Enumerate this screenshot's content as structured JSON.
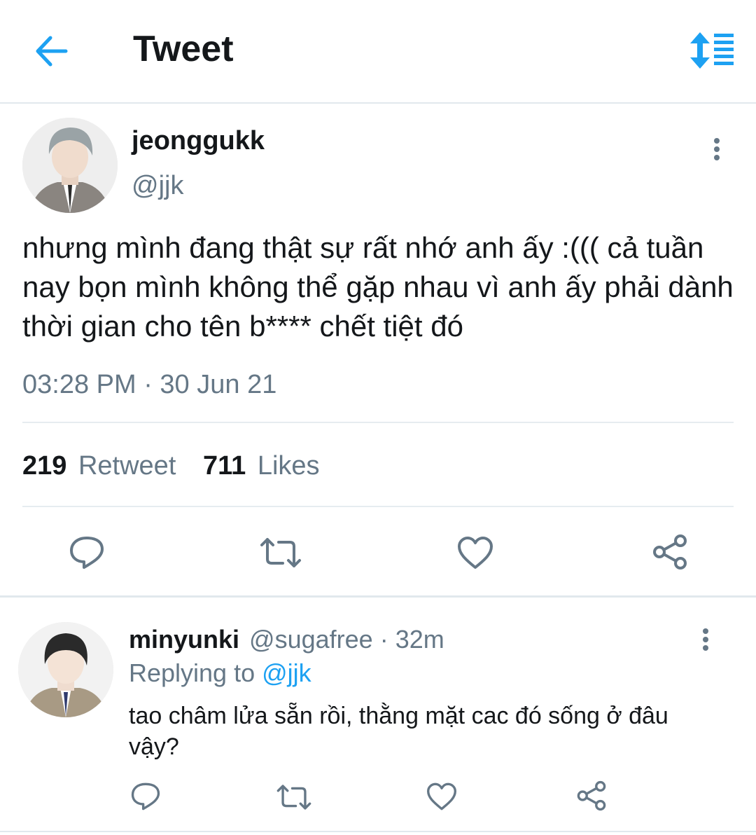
{
  "header": {
    "title": "Tweet",
    "back_icon": "arrow-left-icon",
    "sort_icon": "sort-list-icon",
    "accent": "#1da1f2"
  },
  "tweet": {
    "display_name": "jeonggukk",
    "handle": "@jjk",
    "text": "nhưng mình đang thật sự rất nhớ anh ấy :((( cả tuần nay bọn mình không thể gặp nhau vì anh ấy phải dành thời gian cho tên b**** chết tiệt đó",
    "timestamp": "03:28 PM · 30 Jun 21",
    "retweet_count": "219",
    "retweet_label": "Retweet",
    "like_count": "711",
    "like_label": "Likes"
  },
  "reply": {
    "display_name": "minyunki",
    "handle": "@sugafree",
    "time": "· 32m",
    "replying_to_label": "Replying to",
    "replying_to_handle": "@jjk",
    "text": "tao châm lửa sẵn rồi, thằng mặt cac đó sống ở đâu vậy?"
  },
  "actions": [
    "reply-icon",
    "retweet-icon",
    "like-icon",
    "share-icon"
  ]
}
